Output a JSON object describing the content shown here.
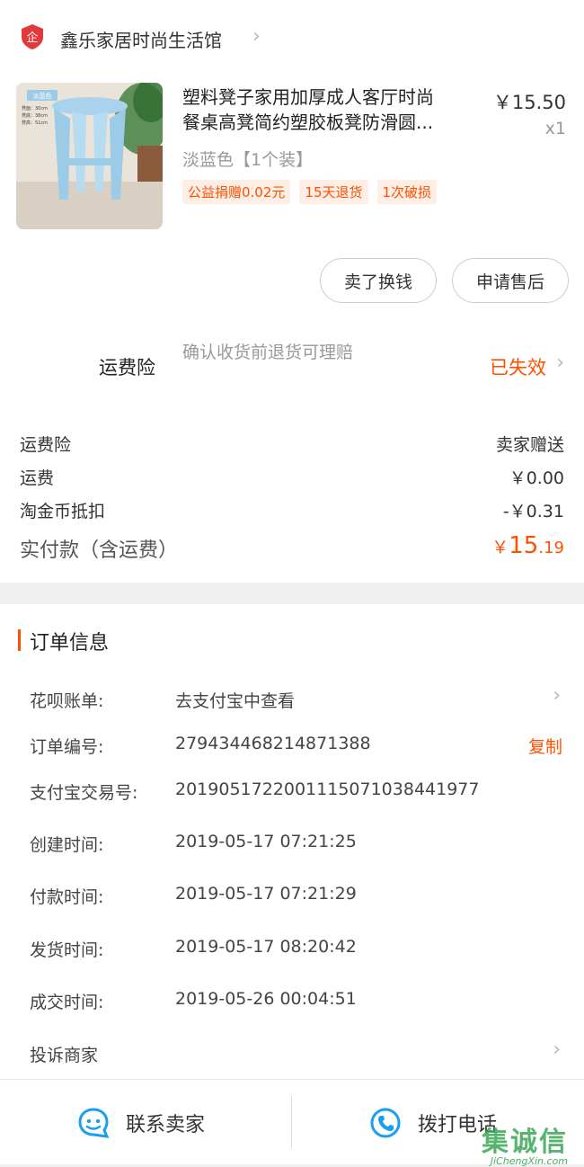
{
  "shop": {
    "name": "鑫乐家居时尚生活馆",
    "icon": "shop-enterprise-icon",
    "icon_glyph": "企"
  },
  "product": {
    "title_line1": "塑料凳子家用加厚成人客厅时尚",
    "title_line2": "餐桌高凳简约塑胶板凳防滑圆...",
    "price": "￥15.50",
    "qty": "x1",
    "sku": "淡蓝色【1个装】",
    "tags": [
      "公益捐赠0.02元",
      "15天退货",
      "1次破损"
    ],
    "image_label": "淡蓝色",
    "image_specs": [
      "凳面：30cm",
      "凳底：38cm",
      "凳高：51cm"
    ]
  },
  "actions": {
    "sell_label": "卖了换钱",
    "after_sale_label": "申请售后"
  },
  "insurance": {
    "label": "运费险",
    "desc": "确认收货前退货可理赔",
    "status": "已失效"
  },
  "fees": [
    {
      "label": "运费险",
      "value": "卖家赠送"
    },
    {
      "label": "运费",
      "value": "￥0.00"
    },
    {
      "label": "淘金币抵扣",
      "value": "-￥0.31"
    }
  ],
  "total": {
    "label": "实付款（含运费）",
    "currency": "￥",
    "int": "15",
    "dec": ".19"
  },
  "order": {
    "title": "订单信息",
    "rows": [
      {
        "label": "花呗账单:",
        "value": "去支付宝中查看"
      },
      {
        "label": "订单编号:",
        "value": "279434468214871388",
        "action": "复制"
      },
      {
        "label": "支付宝交易号:",
        "value": "2019051722001115071038441977"
      },
      {
        "label": "创建时间:",
        "value": "2019-05-17 07:21:25"
      },
      {
        "label": "付款时间:",
        "value": "2019-05-17 07:21:29"
      },
      {
        "label": "发货时间:",
        "value": "2019-05-17 08:20:42"
      },
      {
        "label": "成交时间:",
        "value": "2019-05-26 00:04:51"
      },
      {
        "label": "投诉商家",
        "value": ""
      }
    ]
  },
  "bottom": {
    "contact_label": "联系卖家",
    "contact_icon": "chat-bubble-icon",
    "call_label": "拨打电话",
    "call_icon": "phone-icon"
  },
  "watermark": {
    "text": "集诚信",
    "sub": "JiChengXin.com"
  },
  "colors": {
    "accent": "#ff5000",
    "link_blue": "#1a9ff0",
    "watermark_green": "#3aa757"
  }
}
